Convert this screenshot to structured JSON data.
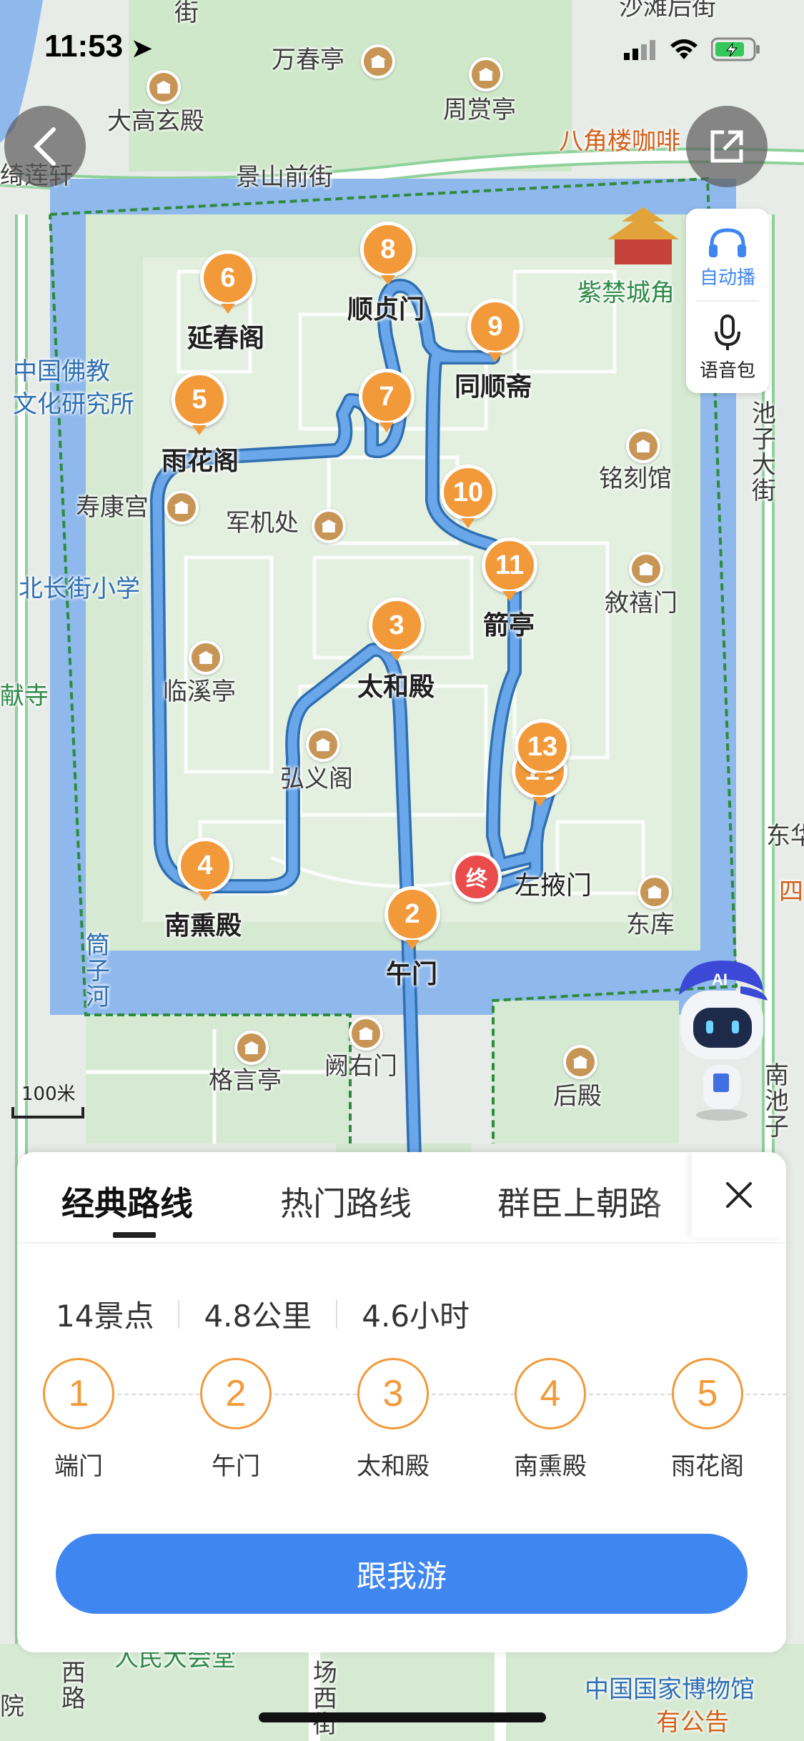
{
  "status_bar": {
    "time": "11:53"
  },
  "map": {
    "labels": {
      "jie_top": "街",
      "shatan_houjie": "沙滩后街",
      "wanchun_ting": "万春亭",
      "zhoushang_ting": "周赏亭",
      "dagaoxuan_dian": "大高玄殿",
      "bajiaolou_kafei": "八角楼咖啡",
      "qilian_xuan": "绮莲轩",
      "jingshan_qianjie": "景山前街",
      "zijincheng_jiao": "紫禁城角",
      "zhongguo_fojiao": "中国佛教",
      "wenhua_yanjiusuo": "文化研究所",
      "chizi_dajie": "池子大街",
      "mingke_guan": "铭刻馆",
      "shoukang_gong": "寿康宫",
      "junji_chu": "军机处",
      "beichangjie_xiaoxue": "北长街小学",
      "xuxi_men": "敘禧门",
      "xianyou_si": "献寺",
      "linxi_ting": "临溪亭",
      "hongyi_ge": "弘义阁",
      "dong_hua": "东华",
      "si": "四",
      "dong_ku": "东库",
      "tongzi_he": "筒子河",
      "geyan_ting": "格言亭",
      "queyou_men": "阙右门",
      "hou_dian": "后殿",
      "nanchizi": "南池子",
      "renmin_dahuitang": "人民大会堂",
      "xixi_lu": "西路",
      "changxi": "场西街",
      "guojia_bowuguan": "中国国家博物馆",
      "you_gonggao": "有公告",
      "yuan": "院"
    },
    "stops": {
      "s2": {
        "num": "2",
        "name": "午门"
      },
      "s3": {
        "num": "3",
        "name": "太和殿"
      },
      "s4": {
        "num": "4",
        "name": "南熏殿"
      },
      "s5": {
        "num": "5",
        "name": "雨花阁"
      },
      "s6": {
        "num": "6",
        "name": "延春阁"
      },
      "s7": {
        "num": "7",
        "name": ""
      },
      "s8": {
        "num": "8",
        "name": "顺贞门"
      },
      "s9": {
        "num": "9",
        "name": "同顺斋"
      },
      "s10": {
        "num": "10",
        "name": ""
      },
      "s11": {
        "num": "11",
        "name": "箭亭"
      },
      "s12": {
        "num": "12",
        "name": ""
      },
      "s13": {
        "num": "13",
        "name": ""
      },
      "end": {
        "label": "终",
        "name": "左掖门"
      }
    },
    "scale": "100米"
  },
  "audio": {
    "auto_play": "自动播",
    "voice_pack": "语音包"
  },
  "sheet": {
    "tabs": [
      "经典路线",
      "热门路线",
      "群臣上朝路"
    ],
    "active_tab": 0,
    "stats": {
      "spots": "14景点",
      "distance": "4.8公里",
      "duration": "4.6小时"
    },
    "route_stops": [
      {
        "num": "1",
        "name": "端门"
      },
      {
        "num": "2",
        "name": "午门"
      },
      {
        "num": "3",
        "name": "太和殿"
      },
      {
        "num": "4",
        "name": "南熏殿"
      },
      {
        "num": "5",
        "name": "雨花阁"
      }
    ],
    "cta_label": "跟我游"
  },
  "colors": {
    "route": "#4a90d9",
    "marker": "#f29a3a",
    "end_marker": "#ea4c4c",
    "cta": "#3f86f1",
    "moat": "#8fb8ec"
  },
  "robot": {
    "label": "AI"
  }
}
